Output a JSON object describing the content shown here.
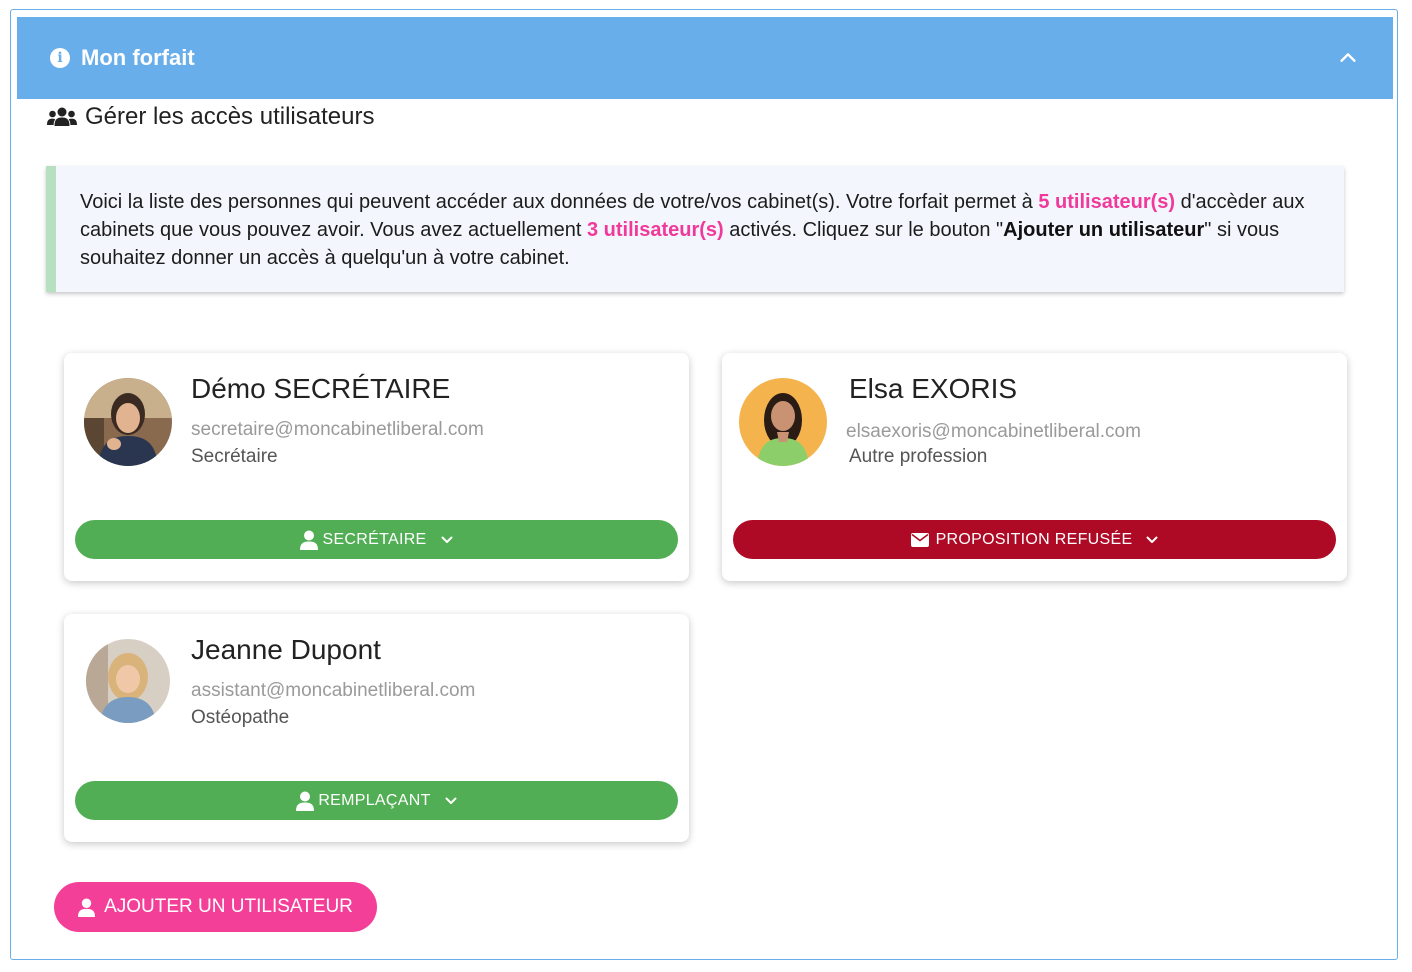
{
  "header": {
    "title": "Mon forfait",
    "accent": "#68aeea"
  },
  "section": {
    "title": "Gérer les accès utilisateurs"
  },
  "notice": {
    "text1": "Voici la liste des personnes qui peuvent accéder aux données de votre/vos cabinet(s). Votre forfait permet à ",
    "highlight1": "5 utilisateur(s)",
    "text2": " d'accèder aux cabinets que vous pouvez avoir. Vous avez actuellement ",
    "highlight2": "3 utilisateur(s)",
    "text3": " activés. Cliquez sur le bouton \"",
    "bold": "Ajouter un utilisateur",
    "text4": "\" si vous souhaitez donner un accès à quelqu'un à votre cabinet.",
    "highlight_color": "#f0399b"
  },
  "users": [
    {
      "name": "Démo SECRÉTAIRE",
      "email": "secretaire@moncabinetliberal.com",
      "profession": "Secrétaire",
      "status_label": "SECRÉTAIRE",
      "status_icon": "user-icon",
      "status_color": "#51ae54"
    },
    {
      "name": "Elsa EXORIS",
      "email": "elsaexoris@moncabinetliberal.com",
      "profession": "Autre profession",
      "status_label": "PROPOSITION REFUSÉE",
      "status_icon": "envelope-icon",
      "status_color": "#ae0a25"
    },
    {
      "name": "Jeanne Dupont",
      "email": "assistant@moncabinetliberal.com",
      "profession": "Ostéopathe",
      "status_label": "REMPLAÇANT",
      "status_icon": "user-icon",
      "status_color": "#51ae54"
    }
  ],
  "add_button": {
    "label": "AJOUTER UN UTILISATEUR",
    "color": "#f43f99"
  }
}
